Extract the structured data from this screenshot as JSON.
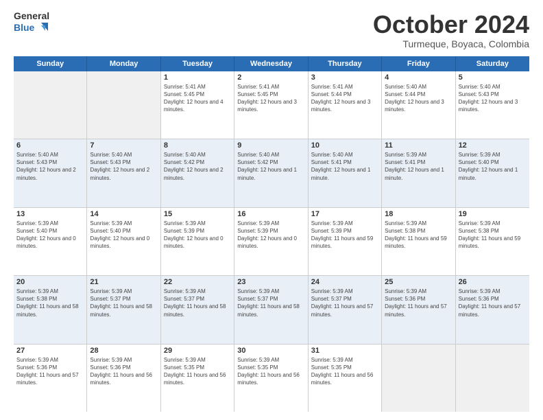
{
  "header": {
    "logo_line1": "General",
    "logo_line2": "Blue",
    "month": "October 2024",
    "location": "Turmeque, Boyaca, Colombia"
  },
  "days": [
    "Sunday",
    "Monday",
    "Tuesday",
    "Wednesday",
    "Thursday",
    "Friday",
    "Saturday"
  ],
  "rows": [
    [
      {
        "date": "",
        "sunrise": "",
        "sunset": "",
        "daylight": "",
        "empty": true
      },
      {
        "date": "",
        "sunrise": "",
        "sunset": "",
        "daylight": "",
        "empty": true
      },
      {
        "date": "1",
        "sunrise": "Sunrise: 5:41 AM",
        "sunset": "Sunset: 5:45 PM",
        "daylight": "Daylight: 12 hours and 4 minutes.",
        "empty": false
      },
      {
        "date": "2",
        "sunrise": "Sunrise: 5:41 AM",
        "sunset": "Sunset: 5:45 PM",
        "daylight": "Daylight: 12 hours and 3 minutes.",
        "empty": false
      },
      {
        "date": "3",
        "sunrise": "Sunrise: 5:41 AM",
        "sunset": "Sunset: 5:44 PM",
        "daylight": "Daylight: 12 hours and 3 minutes.",
        "empty": false
      },
      {
        "date": "4",
        "sunrise": "Sunrise: 5:40 AM",
        "sunset": "Sunset: 5:44 PM",
        "daylight": "Daylight: 12 hours and 3 minutes.",
        "empty": false
      },
      {
        "date": "5",
        "sunrise": "Sunrise: 5:40 AM",
        "sunset": "Sunset: 5:43 PM",
        "daylight": "Daylight: 12 hours and 3 minutes.",
        "empty": false
      }
    ],
    [
      {
        "date": "6",
        "sunrise": "Sunrise: 5:40 AM",
        "sunset": "Sunset: 5:43 PM",
        "daylight": "Daylight: 12 hours and 2 minutes.",
        "empty": false
      },
      {
        "date": "7",
        "sunrise": "Sunrise: 5:40 AM",
        "sunset": "Sunset: 5:43 PM",
        "daylight": "Daylight: 12 hours and 2 minutes.",
        "empty": false
      },
      {
        "date": "8",
        "sunrise": "Sunrise: 5:40 AM",
        "sunset": "Sunset: 5:42 PM",
        "daylight": "Daylight: 12 hours and 2 minutes.",
        "empty": false
      },
      {
        "date": "9",
        "sunrise": "Sunrise: 5:40 AM",
        "sunset": "Sunset: 5:42 PM",
        "daylight": "Daylight: 12 hours and 1 minute.",
        "empty": false
      },
      {
        "date": "10",
        "sunrise": "Sunrise: 5:40 AM",
        "sunset": "Sunset: 5:41 PM",
        "daylight": "Daylight: 12 hours and 1 minute.",
        "empty": false
      },
      {
        "date": "11",
        "sunrise": "Sunrise: 5:39 AM",
        "sunset": "Sunset: 5:41 PM",
        "daylight": "Daylight: 12 hours and 1 minute.",
        "empty": false
      },
      {
        "date": "12",
        "sunrise": "Sunrise: 5:39 AM",
        "sunset": "Sunset: 5:40 PM",
        "daylight": "Daylight: 12 hours and 1 minute.",
        "empty": false
      }
    ],
    [
      {
        "date": "13",
        "sunrise": "Sunrise: 5:39 AM",
        "sunset": "Sunset: 5:40 PM",
        "daylight": "Daylight: 12 hours and 0 minutes.",
        "empty": false
      },
      {
        "date": "14",
        "sunrise": "Sunrise: 5:39 AM",
        "sunset": "Sunset: 5:40 PM",
        "daylight": "Daylight: 12 hours and 0 minutes.",
        "empty": false
      },
      {
        "date": "15",
        "sunrise": "Sunrise: 5:39 AM",
        "sunset": "Sunset: 5:39 PM",
        "daylight": "Daylight: 12 hours and 0 minutes.",
        "empty": false
      },
      {
        "date": "16",
        "sunrise": "Sunrise: 5:39 AM",
        "sunset": "Sunset: 5:39 PM",
        "daylight": "Daylight: 12 hours and 0 minutes.",
        "empty": false
      },
      {
        "date": "17",
        "sunrise": "Sunrise: 5:39 AM",
        "sunset": "Sunset: 5:39 PM",
        "daylight": "Daylight: 11 hours and 59 minutes.",
        "empty": false
      },
      {
        "date": "18",
        "sunrise": "Sunrise: 5:39 AM",
        "sunset": "Sunset: 5:38 PM",
        "daylight": "Daylight: 11 hours and 59 minutes.",
        "empty": false
      },
      {
        "date": "19",
        "sunrise": "Sunrise: 5:39 AM",
        "sunset": "Sunset: 5:38 PM",
        "daylight": "Daylight: 11 hours and 59 minutes.",
        "empty": false
      }
    ],
    [
      {
        "date": "20",
        "sunrise": "Sunrise: 5:39 AM",
        "sunset": "Sunset: 5:38 PM",
        "daylight": "Daylight: 11 hours and 58 minutes.",
        "empty": false
      },
      {
        "date": "21",
        "sunrise": "Sunrise: 5:39 AM",
        "sunset": "Sunset: 5:37 PM",
        "daylight": "Daylight: 11 hours and 58 minutes.",
        "empty": false
      },
      {
        "date": "22",
        "sunrise": "Sunrise: 5:39 AM",
        "sunset": "Sunset: 5:37 PM",
        "daylight": "Daylight: 11 hours and 58 minutes.",
        "empty": false
      },
      {
        "date": "23",
        "sunrise": "Sunrise: 5:39 AM",
        "sunset": "Sunset: 5:37 PM",
        "daylight": "Daylight: 11 hours and 58 minutes.",
        "empty": false
      },
      {
        "date": "24",
        "sunrise": "Sunrise: 5:39 AM",
        "sunset": "Sunset: 5:37 PM",
        "daylight": "Daylight: 11 hours and 57 minutes.",
        "empty": false
      },
      {
        "date": "25",
        "sunrise": "Sunrise: 5:39 AM",
        "sunset": "Sunset: 5:36 PM",
        "daylight": "Daylight: 11 hours and 57 minutes.",
        "empty": false
      },
      {
        "date": "26",
        "sunrise": "Sunrise: 5:39 AM",
        "sunset": "Sunset: 5:36 PM",
        "daylight": "Daylight: 11 hours and 57 minutes.",
        "empty": false
      }
    ],
    [
      {
        "date": "27",
        "sunrise": "Sunrise: 5:39 AM",
        "sunset": "Sunset: 5:36 PM",
        "daylight": "Daylight: 11 hours and 57 minutes.",
        "empty": false
      },
      {
        "date": "28",
        "sunrise": "Sunrise: 5:39 AM",
        "sunset": "Sunset: 5:36 PM",
        "daylight": "Daylight: 11 hours and 56 minutes.",
        "empty": false
      },
      {
        "date": "29",
        "sunrise": "Sunrise: 5:39 AM",
        "sunset": "Sunset: 5:35 PM",
        "daylight": "Daylight: 11 hours and 56 minutes.",
        "empty": false
      },
      {
        "date": "30",
        "sunrise": "Sunrise: 5:39 AM",
        "sunset": "Sunset: 5:35 PM",
        "daylight": "Daylight: 11 hours and 56 minutes.",
        "empty": false
      },
      {
        "date": "31",
        "sunrise": "Sunrise: 5:39 AM",
        "sunset": "Sunset: 5:35 PM",
        "daylight": "Daylight: 11 hours and 56 minutes.",
        "empty": false
      },
      {
        "date": "",
        "sunrise": "",
        "sunset": "",
        "daylight": "",
        "empty": true
      },
      {
        "date": "",
        "sunrise": "",
        "sunset": "",
        "daylight": "",
        "empty": true
      }
    ]
  ]
}
